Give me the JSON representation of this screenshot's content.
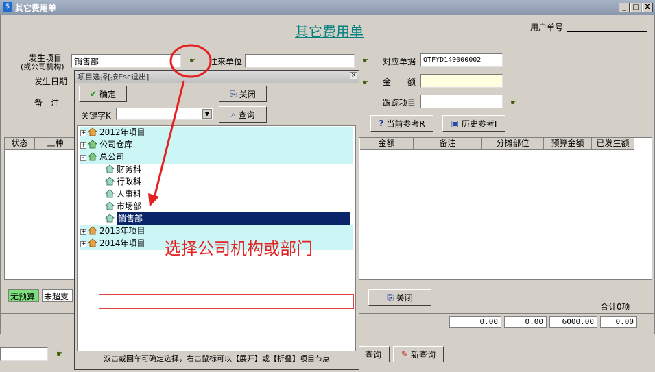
{
  "window": {
    "title": "其它费用单",
    "min": "_",
    "max": "□",
    "close": "X"
  },
  "heading": "其它费用单",
  "user_no_label": "用户单号",
  "form": {
    "item_label_1": "发生项目",
    "item_label_2": "(或公司机构)",
    "item_value": "销售部",
    "date_label": "发生日期",
    "remark_label": "备　注",
    "partner_label": "往来单位",
    "partner_value": "",
    "ref_label": "对应单据",
    "ref_value": "QTFYD140000002",
    "amount_label": "金　　额",
    "track_label": "跟踪项目"
  },
  "buttons": {
    "current_ref": "当前参考R",
    "history_ref": "历史参考I",
    "close_main": "关闭",
    "query": "查询",
    "new_query": "新查询"
  },
  "grid": {
    "columns_left": [
      "状态",
      "工种"
    ],
    "columns_right": [
      "金额",
      "备注",
      "分摊部位",
      "预算金额",
      "已发生额"
    ],
    "no_budget": "无预算",
    "not_over": "未超支",
    "total": "合计0项",
    "sums": [
      "0.00",
      "0.00",
      "6000.00",
      "0.00"
    ]
  },
  "dialog": {
    "title": "项目选择[按Esc退出]",
    "confirm": "确定",
    "close": "关闭",
    "keyword_label": "关键字K",
    "query": "查询",
    "hint": "双击或回车可确定选择，右击鼠标可以【展开】或【折叠】项目节点",
    "tree": [
      {
        "label": "2012年项目",
        "level": 0,
        "expander": "+"
      },
      {
        "label": "公司仓库",
        "level": 0,
        "expander": "+"
      },
      {
        "label": "总公司",
        "level": 0,
        "expander": "-"
      },
      {
        "label": "财务科",
        "level": 1,
        "expander": ""
      },
      {
        "label": "行政科",
        "level": 1,
        "expander": ""
      },
      {
        "label": "人事科",
        "level": 1,
        "expander": ""
      },
      {
        "label": "市场部",
        "level": 1,
        "expander": ""
      },
      {
        "label": "销售部",
        "level": 1,
        "expander": "",
        "selected": true
      },
      {
        "label": "2013年项目",
        "level": 0,
        "expander": "+"
      },
      {
        "label": "2014年项目",
        "level": 0,
        "expander": "+"
      }
    ]
  },
  "annotation": "选择公司机构或部门",
  "colors": {
    "heading": "#008080",
    "selected": "#0a246a",
    "highlight": "#ccf5f5",
    "annotation": "#e52020",
    "amount_field": "#ffffe0"
  }
}
